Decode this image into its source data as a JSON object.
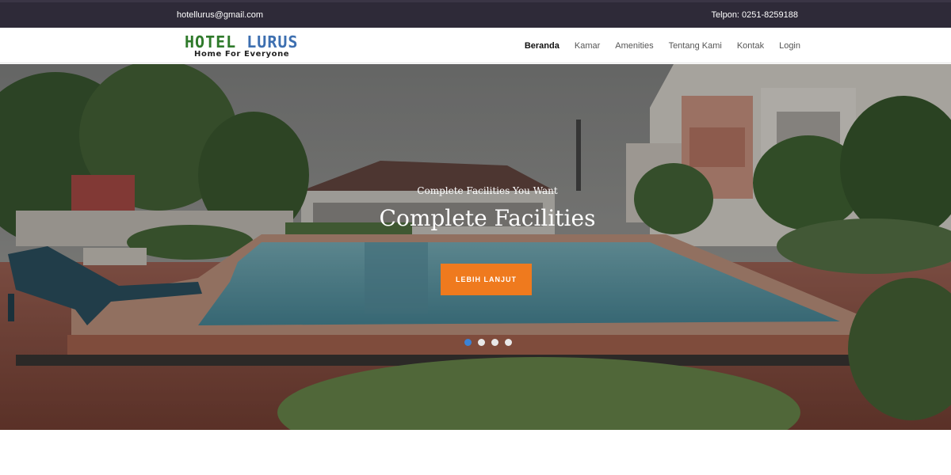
{
  "topbar": {
    "email": "hotellurus@gmail.com",
    "phone": "Telpon: 0251-8259188"
  },
  "brand": {
    "name_part1": "HOTEL",
    "name_part2": "LURUS",
    "tagline": "Home For Everyone",
    "colors": {
      "green": "#2f7a2b",
      "blue": "#3d6fb0"
    }
  },
  "nav": {
    "items": [
      {
        "label": "Beranda",
        "active": true
      },
      {
        "label": "Kamar"
      },
      {
        "label": "Amenities"
      },
      {
        "label": "Tentang Kami"
      },
      {
        "label": "Kontak"
      },
      {
        "label": "Login"
      }
    ]
  },
  "hero": {
    "subtitle": "Complete Facilities You Want",
    "title": "Complete Facilities",
    "cta_label": "LEBIH LANJUT",
    "cta_color": "#ef7a1e",
    "slides_total": 4,
    "active_slide": 1
  }
}
